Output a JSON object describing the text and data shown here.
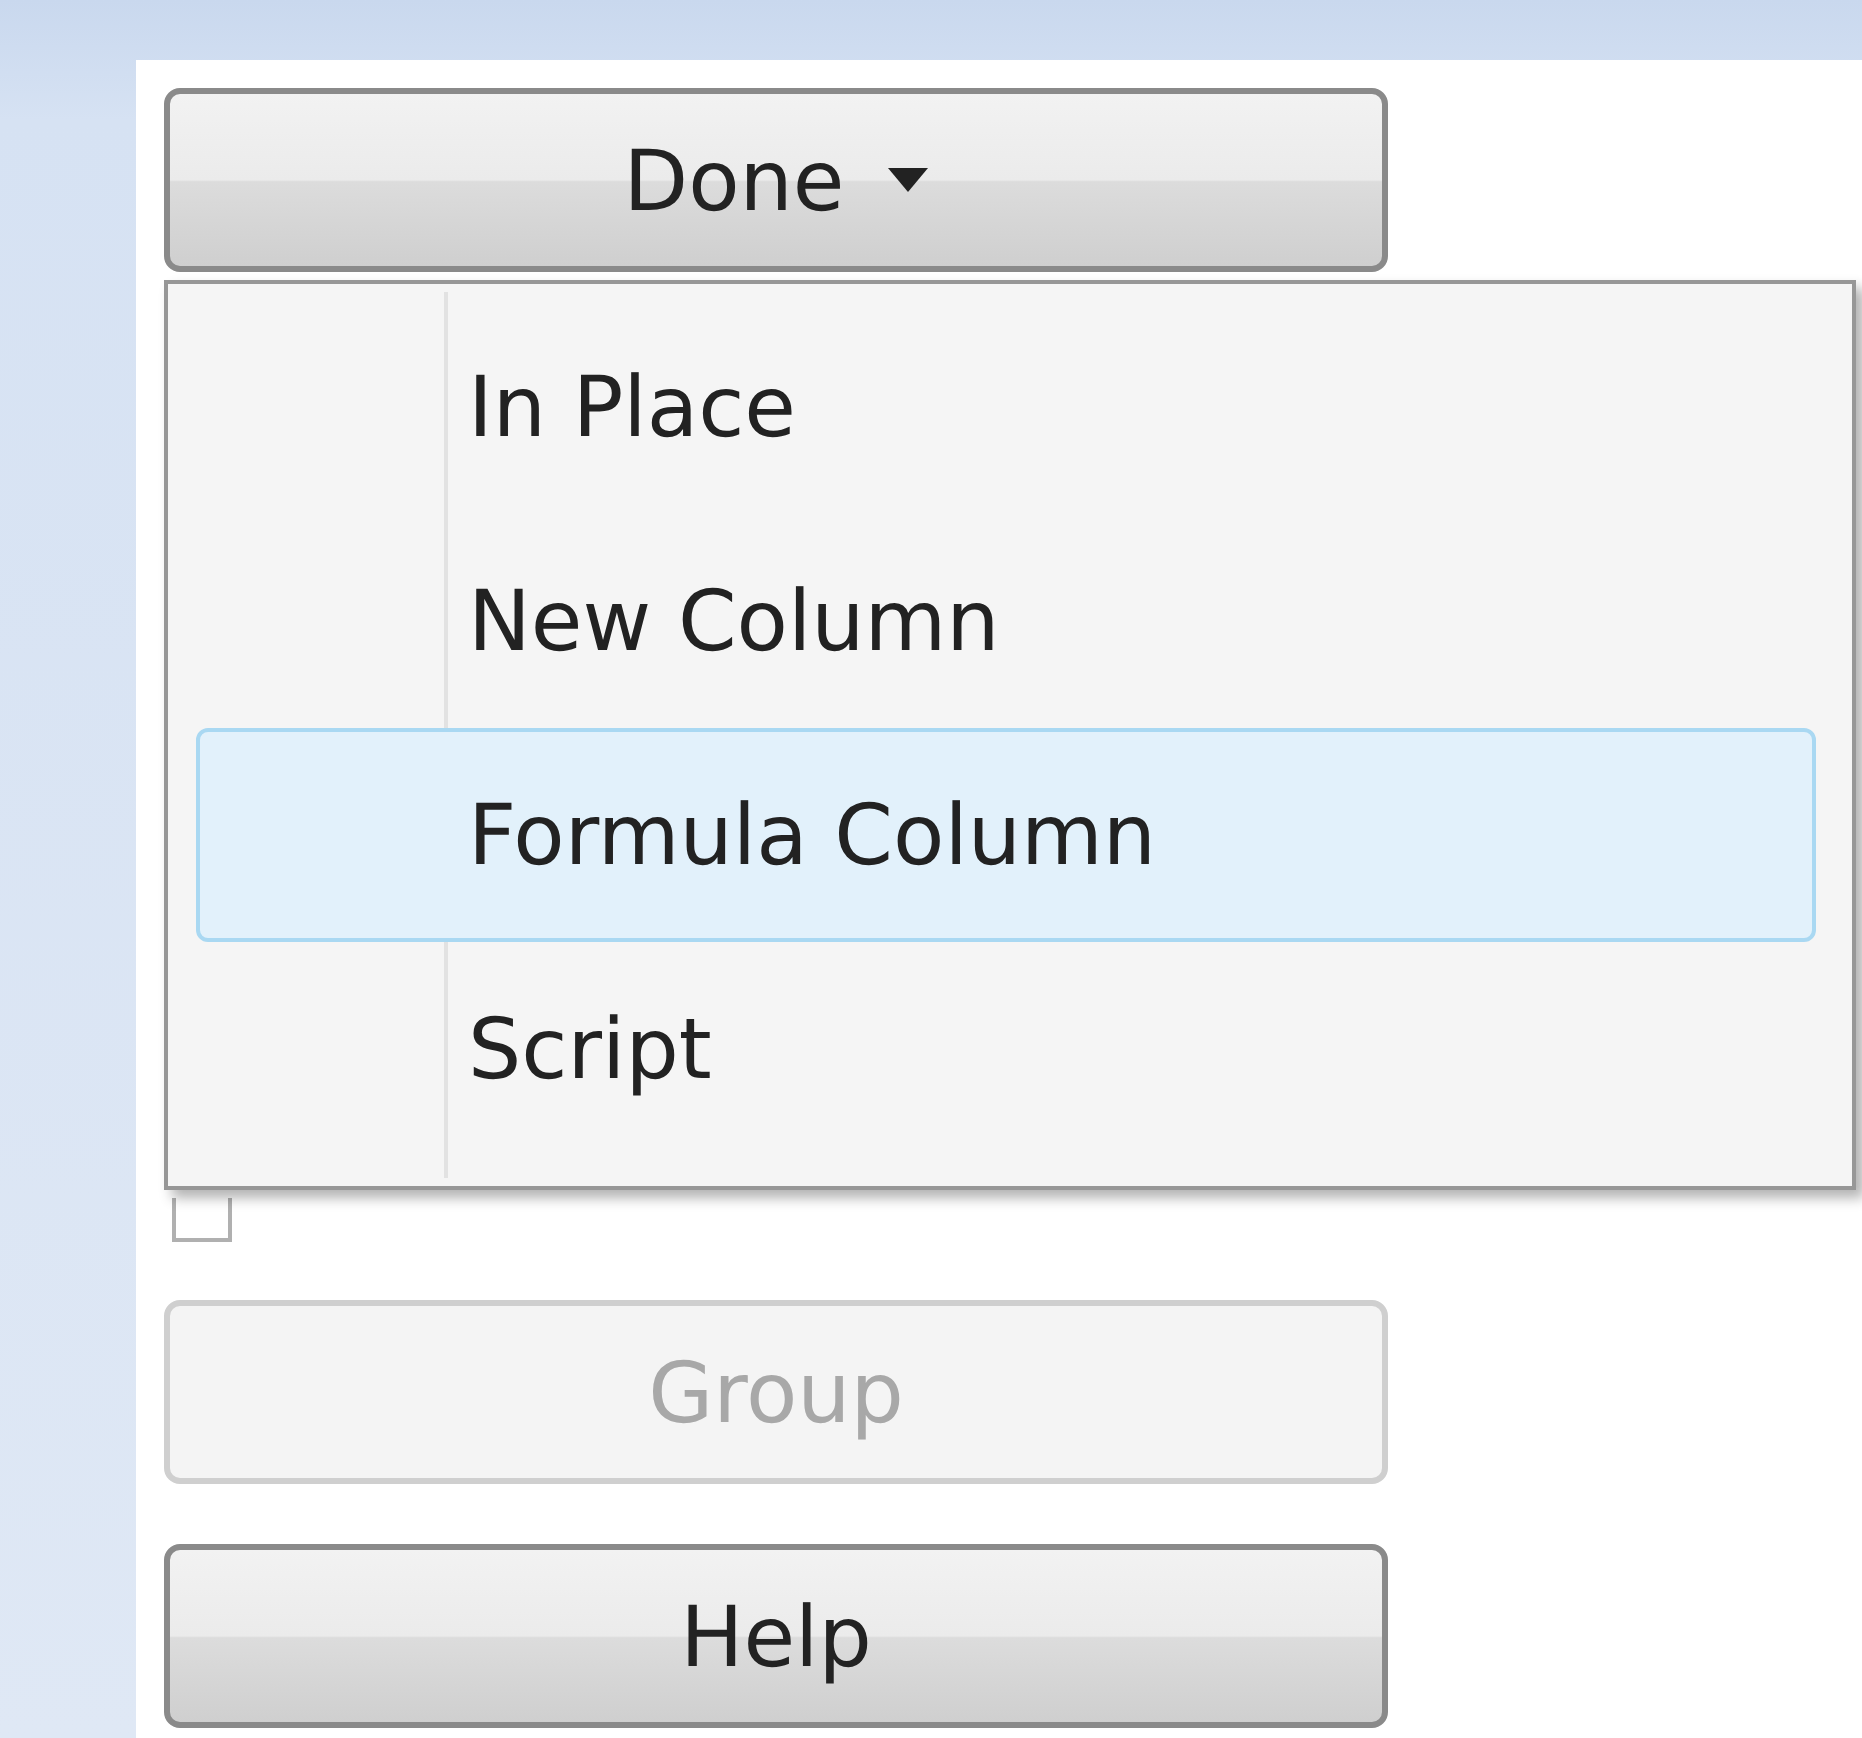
{
  "done_button": {
    "label": "Done"
  },
  "menu": {
    "items": [
      {
        "label": "In Place",
        "selected": false
      },
      {
        "label": "New Column",
        "selected": false
      },
      {
        "label": "Formula Column",
        "selected": true
      },
      {
        "label": "Script",
        "selected": false
      }
    ]
  },
  "show_only_ungrouped": {
    "checked": false
  },
  "buttons": [
    {
      "label": "Group",
      "disabled": true
    },
    {
      "label": "Help",
      "disabled": false
    }
  ]
}
